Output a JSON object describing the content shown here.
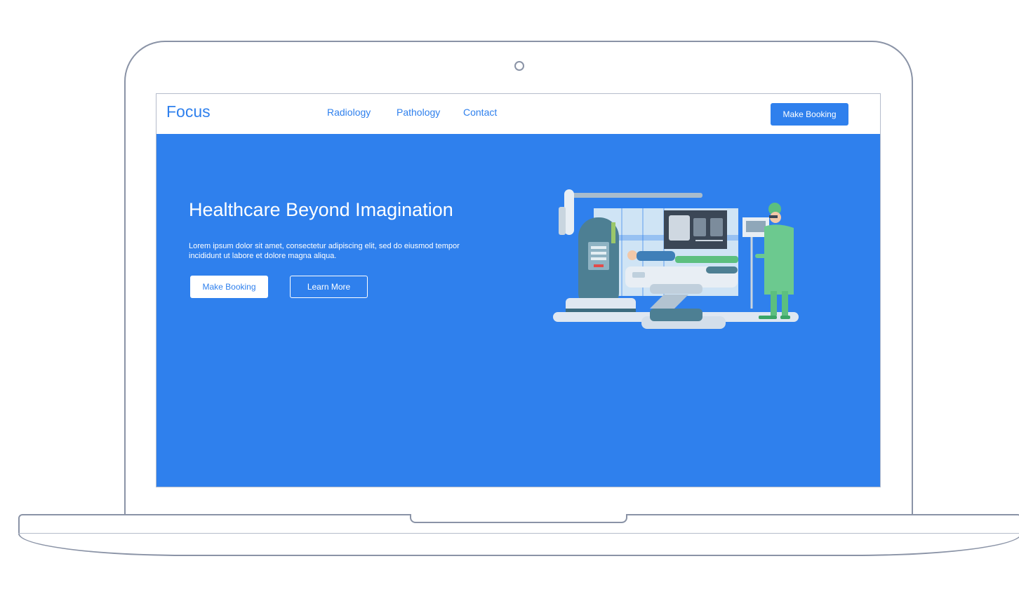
{
  "brand": "Focus",
  "nav": {
    "links": [
      "Radiology",
      "Pathology",
      "Contact"
    ],
    "cta_label": "Make Booking"
  },
  "hero": {
    "title": "Healthcare Beyond Imagination",
    "body": "Lorem ipsum dolor sit amet, consectetur adipiscing elit, sed do eiusmod tempor incididunt ut labore et dolore magna aliqua.",
    "primary_label": "Make Booking",
    "secondary_label": "Learn More",
    "illustration": "mri-scan-illustration"
  },
  "colors": {
    "primary": "#2f80ed",
    "frame": "#8a93a6",
    "white": "#ffffff"
  }
}
